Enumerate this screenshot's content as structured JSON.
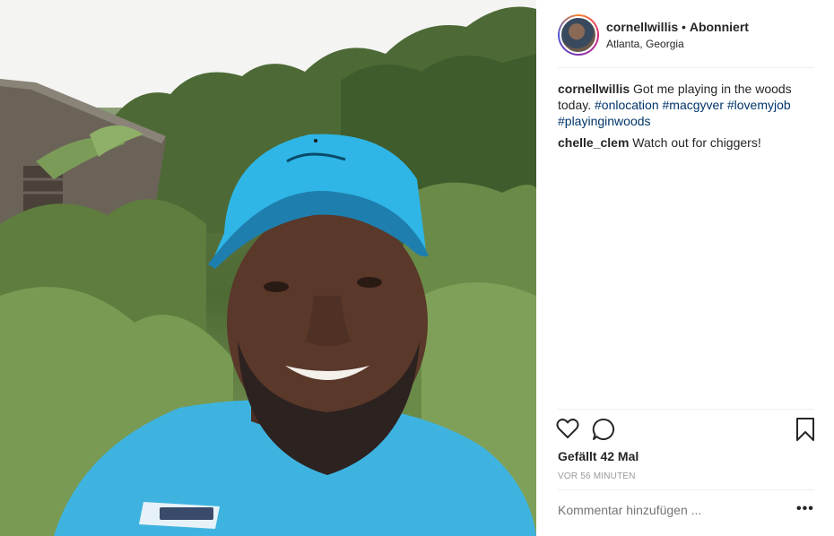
{
  "post": {
    "username": "cornellwillis",
    "separator": "•",
    "follow_status": "Abonniert",
    "location": "Atlanta, Georgia"
  },
  "caption": {
    "username": "cornellwillis",
    "text": "Got me playing in the woods today.",
    "hashtags": [
      "#onlocation",
      "#macgyver",
      "#lovemyjob",
      "#playinginwoods"
    ]
  },
  "comments": [
    {
      "username": "chelle_clem",
      "text": "Watch out for chiggers!"
    }
  ],
  "actions": {
    "like_icon": "heart-outline-icon",
    "comment_icon": "comment-bubble-icon",
    "save_icon": "bookmark-icon"
  },
  "likes_text": "Gefällt 42 Mal",
  "timestamp": "VOR 56 MINUTEN",
  "add_comment_placeholder": "Kommentar hinzufügen ...",
  "more_options": "•••",
  "colors": {
    "hashtag": "#003569",
    "text": "#262626",
    "muted": "#999999",
    "border": "#efefef"
  }
}
